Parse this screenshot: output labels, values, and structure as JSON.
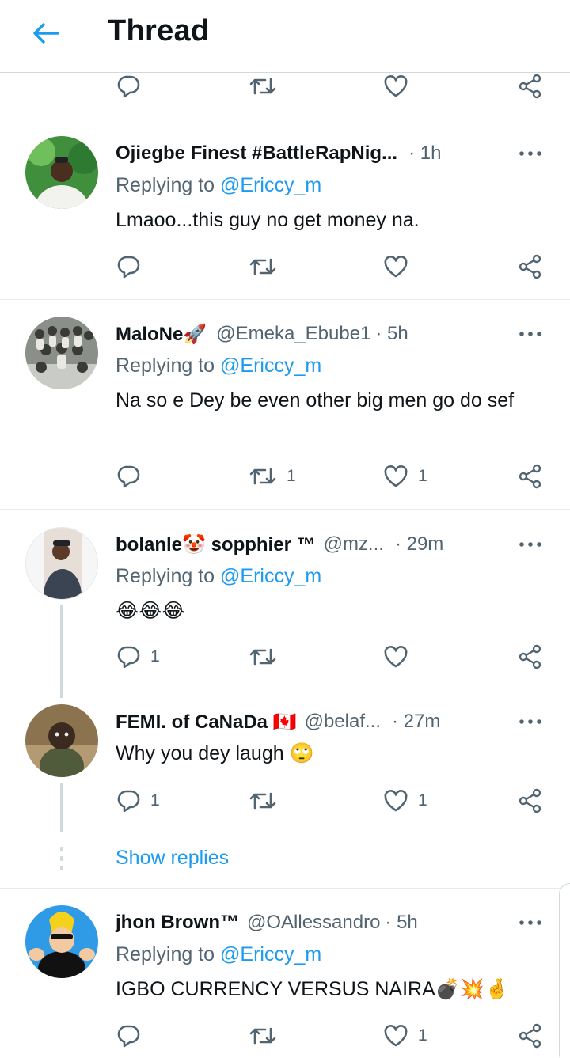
{
  "header": {
    "title": "Thread"
  },
  "colors": {
    "accent": "#1d9bf0",
    "muted": "#536471",
    "text": "#0f1419",
    "divider": "#cfd9de"
  },
  "tweets": [
    {
      "name": "Ojiegbe Finest #BattleRapNig...",
      "handle": "",
      "time": "· 1h",
      "replying_prefix": "Replying to ",
      "replying_to": "@Ericcy_m",
      "text": "Lmaoo...this guy no get money na.",
      "reply_count": "",
      "retweet_count": "",
      "like_count": ""
    },
    {
      "name": "MaloNe🚀",
      "handle": "@Emeka_Ebube1",
      "time": "· 5h",
      "replying_prefix": "Replying to ",
      "replying_to": "@Ericcy_m",
      "text": "Na so e Dey be even other big men go do sef",
      "reply_count": "",
      "retweet_count": "1",
      "like_count": "1"
    },
    {
      "name": "bolanle🤡 sopphier ™",
      "handle": "@mz...",
      "time": "· 29m",
      "replying_prefix": "Replying to ",
      "replying_to": "@Ericcy_m",
      "text": "😂😂😂",
      "reply_count": "1",
      "retweet_count": "",
      "like_count": ""
    },
    {
      "name": "FEMI. of CaNaDa 🇨🇦",
      "handle": "@belaf...",
      "time": "· 27m",
      "text": "Why you dey laugh 🙄",
      "reply_count": "1",
      "retweet_count": "",
      "like_count": "1"
    },
    {
      "name": "jhon Brown™",
      "handle": "@OAllessandro",
      "time": "· 5h",
      "replying_prefix": "Replying to ",
      "replying_to": "@Ericcy_m",
      "text": "IGBO CURRENCY VERSUS NAIRA💣💥🤞",
      "reply_count": "",
      "retweet_count": "",
      "like_count": "1"
    }
  ],
  "show_replies": "Show replies",
  "icons": [
    "back-arrow-icon",
    "reply-icon",
    "retweet-icon",
    "like-icon",
    "share-icon",
    "more-icon"
  ]
}
